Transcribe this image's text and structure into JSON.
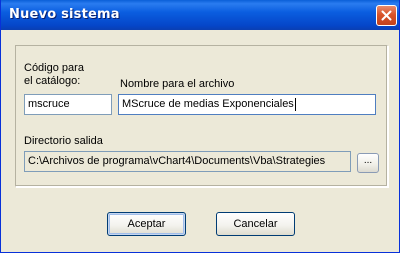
{
  "window": {
    "title": "Nuevo sistema"
  },
  "form": {
    "codigo_label": "Código para\nel catálogo:",
    "codigo_value": "mscruce",
    "nombre_label": "Nombre para el archivo",
    "nombre_value": "MScruce de medias Exponenciales",
    "directorio_label": "Directorio salida",
    "directorio_value": "C:\\Archivos de programa\\vChart4\\Documents\\Vba\\Strategies",
    "browse_label": "..."
  },
  "buttons": {
    "accept_label": "Aceptar",
    "cancel_label": "Cancelar"
  },
  "icons": {
    "close": "close-icon"
  },
  "colors": {
    "titlebar": "#0554d4",
    "close_button": "#d9542a",
    "dialog_background": "#ece9d8",
    "field_border": "#7f9db9"
  }
}
